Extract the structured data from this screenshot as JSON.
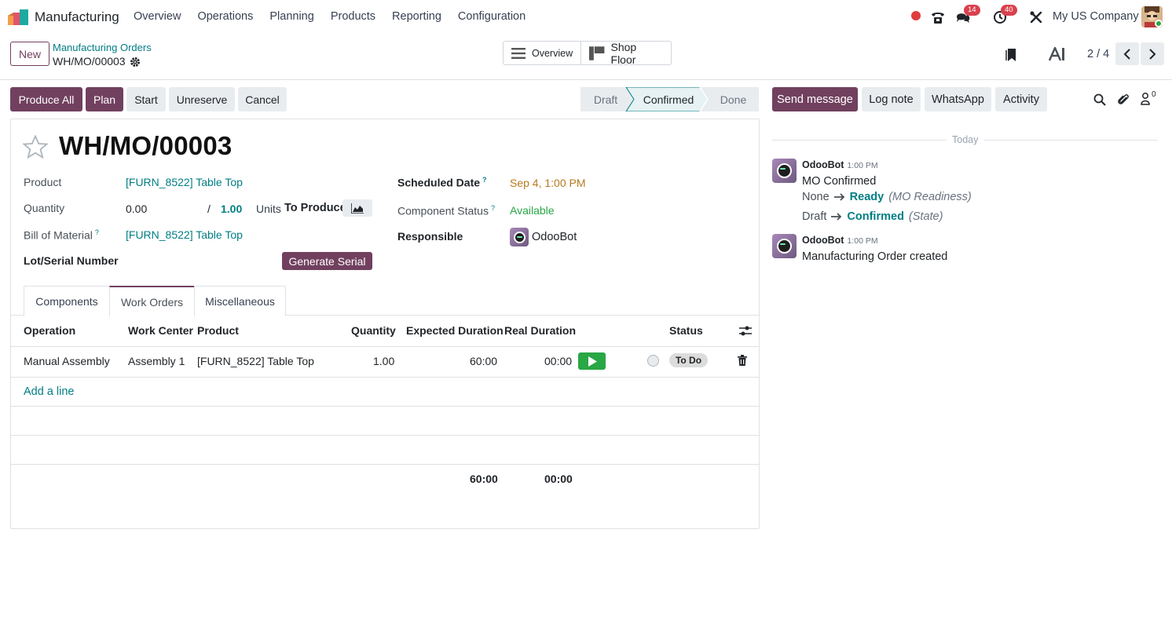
{
  "app": {
    "name": "Manufacturing"
  },
  "menu": [
    "Overview",
    "Operations",
    "Planning",
    "Products",
    "Reporting",
    "Configuration"
  ],
  "systray": {
    "messages_count": "14",
    "activities_count": "40",
    "company": "My US Company"
  },
  "control": {
    "new_label": "New",
    "breadcrumb_parent": "Manufacturing Orders",
    "breadcrumb_current": "WH/MO/00003",
    "overview_label": "Overview",
    "shop_floor_label": "Shop Floor",
    "pager": "2 / 4"
  },
  "actions": {
    "produce_all": "Produce All",
    "plan": "Plan",
    "start": "Start",
    "unreserve": "Unreserve",
    "cancel": "Cancel"
  },
  "stages": {
    "draft": "Draft",
    "confirmed": "Confirmed",
    "done": "Done",
    "active": "Confirmed"
  },
  "record": {
    "name": "WH/MO/00003",
    "product_label": "Product",
    "product": "[FURN_8522] Table Top",
    "quantity_label": "Quantity",
    "qty_produced": "0.00",
    "qty_sep": "/",
    "qty_total": "1.00",
    "uom": "Units",
    "to_produce": "To Produce",
    "bom_label": "Bill of Material",
    "bom": "[FURN_8522] Table Top",
    "lot_label": "Lot/Serial Number",
    "generate_serial": "Generate Serial",
    "scheduled_label": "Scheduled Date",
    "scheduled": "Sep 4, 1:00 PM",
    "component_status_label": "Component Status",
    "component_status": "Available",
    "responsible_label": "Responsible",
    "responsible": "OdooBot",
    "help_mark": "?"
  },
  "tabs": [
    "Components",
    "Work Orders",
    "Miscellaneous"
  ],
  "active_tab": "Work Orders",
  "work_orders": {
    "columns": [
      "Operation",
      "Work Center",
      "Product",
      "Quantity",
      "Expected Duration",
      "Real Duration",
      "Status"
    ],
    "rows": [
      {
        "operation": "Manual Assembly",
        "work_center": "Assembly 1",
        "product": "[FURN_8522] Table Top",
        "quantity": "1.00",
        "expected": "60:00",
        "real": "00:00",
        "status": "To Do"
      }
    ],
    "add_line": "Add a line",
    "total_expected": "60:00",
    "total_real": "00:00"
  },
  "chatter": {
    "send_message": "Send message",
    "log_note": "Log note",
    "whatsapp": "WhatsApp",
    "activity": "Activity",
    "followers_count": "0",
    "today": "Today",
    "messages": [
      {
        "author": "OdooBot",
        "time": "1:00 PM",
        "text": "MO Confirmed",
        "tracking": [
          {
            "old": "None",
            "new": "Ready",
            "field": "(MO Readiness)"
          },
          {
            "old": "Draft",
            "new": "Confirmed",
            "field": "(State)"
          }
        ]
      },
      {
        "author": "OdooBot",
        "time": "1:00 PM",
        "text": "Manufacturing Order created"
      }
    ]
  },
  "colors": {
    "primary": "#71405f",
    "link": "#017e84",
    "success": "#28a745",
    "badge": "#d9414f"
  }
}
